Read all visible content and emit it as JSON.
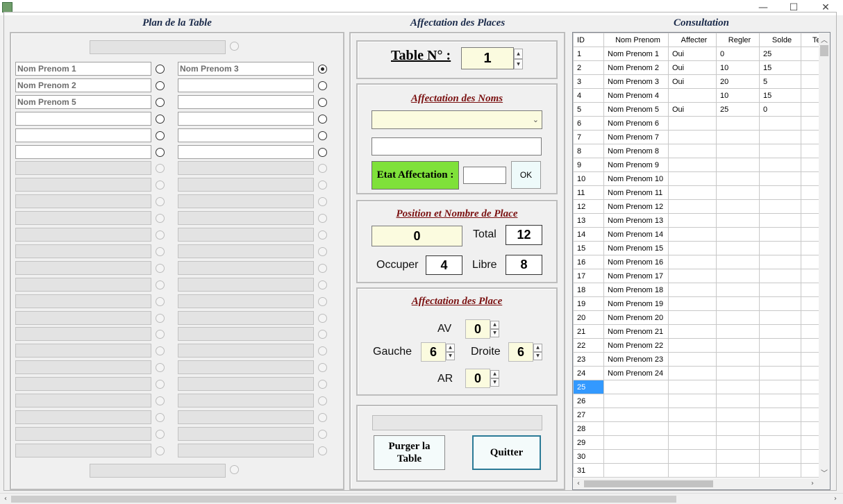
{
  "window": {
    "minimize_icon": "—",
    "maximize_icon": "☐",
    "close_icon": "✕"
  },
  "sections": {
    "plan": "Plan de la Table",
    "affectation": "Affectation des Places",
    "consultation": "Consultation"
  },
  "plan": {
    "left_seats": [
      "Nom Prenom 1",
      "Nom Prenom 2",
      "Nom Prenom 5",
      "",
      "",
      "",
      "",
      "",
      "",
      "",
      "",
      "",
      "",
      "",
      "",
      "",
      "",
      "",
      "",
      "",
      "",
      "",
      "",
      ""
    ],
    "right_seats": [
      "Nom Prenom 3",
      "",
      "",
      "",
      "",
      "",
      "",
      "",
      "",
      "",
      "",
      "",
      "",
      "",
      "",
      "",
      "",
      "",
      "",
      "",
      "",
      "",
      "",
      ""
    ],
    "active_rows": 6,
    "selected_right_row": 0
  },
  "table": {
    "label": "Table N° :",
    "number": "1"
  },
  "noms": {
    "title": "Affectation des Noms",
    "dropdown_value": "",
    "name_input": "",
    "etat_label": "Etat Affectation :",
    "etat_value": "",
    "ok_label": "OK"
  },
  "position": {
    "title": "Position et Nombre de Place",
    "position_value": "0",
    "total_label": "Total",
    "total_value": "12",
    "occuper_label": "Occuper",
    "occuper_value": "4",
    "libre_label": "Libre",
    "libre_value": "8"
  },
  "place": {
    "title": "Affectation des Place",
    "av_label": "AV",
    "av_value": "0",
    "gauche_label": "Gauche",
    "gauche_value": "6",
    "droite_label": "Droite",
    "droite_value": "6",
    "ar_label": "AR",
    "ar_value": "0"
  },
  "actions": {
    "purger_line1": "Purger la",
    "purger_line2": "Table",
    "quitter": "Quitter"
  },
  "grid": {
    "columns": [
      "ID",
      "Nom Prenom",
      "Affecter",
      "Regler",
      "Solde",
      "Tel"
    ],
    "rows": [
      [
        "1",
        "Nom Prenom 1",
        "Oui",
        "0",
        "25"
      ],
      [
        "2",
        "Nom Prenom 2",
        "Oui",
        "10",
        "15"
      ],
      [
        "3",
        "Nom Prenom 3",
        "Oui",
        "20",
        "5"
      ],
      [
        "4",
        "Nom Prenom 4",
        "",
        "10",
        "15"
      ],
      [
        "5",
        "Nom Prenom 5",
        "Oui",
        "25",
        "0"
      ],
      [
        "6",
        "Nom Prenom 6",
        "",
        "",
        ""
      ],
      [
        "7",
        "Nom Prenom 7",
        "",
        "",
        ""
      ],
      [
        "8",
        "Nom Prenom 8",
        "",
        "",
        ""
      ],
      [
        "9",
        "Nom Prenom 9",
        "",
        "",
        ""
      ],
      [
        "10",
        "Nom Prenom 10",
        "",
        "",
        ""
      ],
      [
        "11",
        "Nom Prenom 11",
        "",
        "",
        ""
      ],
      [
        "12",
        "Nom Prenom 12",
        "",
        "",
        ""
      ],
      [
        "13",
        "Nom Prenom 13",
        "",
        "",
        ""
      ],
      [
        "14",
        "Nom Prenom 14",
        "",
        "",
        ""
      ],
      [
        "15",
        "Nom Prenom 15",
        "",
        "",
        ""
      ],
      [
        "16",
        "Nom Prenom 16",
        "",
        "",
        ""
      ],
      [
        "17",
        "Nom Prenom 17",
        "",
        "",
        ""
      ],
      [
        "18",
        "Nom Prenom 18",
        "",
        "",
        ""
      ],
      [
        "19",
        "Nom Prenom 19",
        "",
        "",
        ""
      ],
      [
        "20",
        "Nom Prenom 20",
        "",
        "",
        ""
      ],
      [
        "21",
        "Nom Prenom 21",
        "",
        "",
        ""
      ],
      [
        "22",
        "Nom Prenom 22",
        "",
        "",
        ""
      ],
      [
        "23",
        "Nom Prenom 23",
        "",
        "",
        ""
      ],
      [
        "24",
        "Nom Prenom 24",
        "",
        "",
        ""
      ],
      [
        "25",
        "",
        "",
        "",
        ""
      ],
      [
        "26",
        "",
        "",
        "",
        ""
      ],
      [
        "27",
        "",
        "",
        "",
        ""
      ],
      [
        "28",
        "",
        "",
        "",
        ""
      ],
      [
        "29",
        "",
        "",
        "",
        ""
      ],
      [
        "30",
        "",
        "",
        "",
        ""
      ],
      [
        "31",
        "",
        "",
        "",
        ""
      ]
    ],
    "selected_row": 24
  },
  "colors": {
    "etat_bg": "#7fe13a",
    "selection": "#3399ff",
    "accent_title": "#7a1010"
  }
}
